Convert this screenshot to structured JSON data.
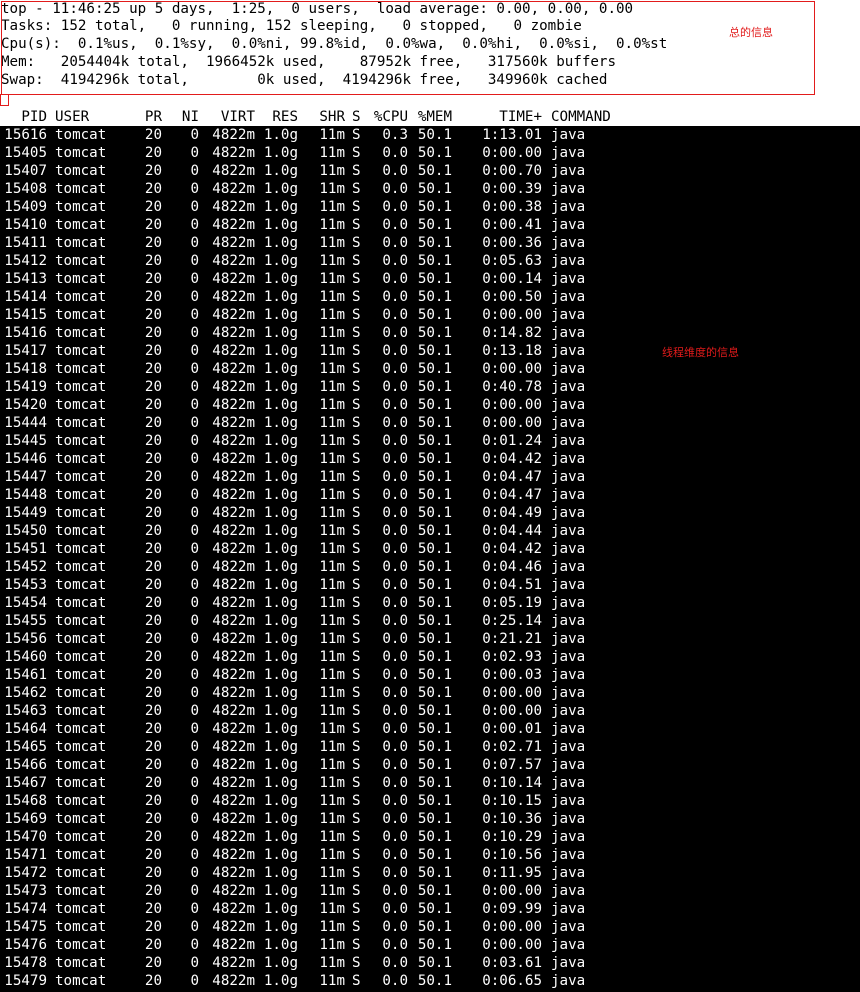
{
  "summary": {
    "lines": [
      "top - 11:46:25 up 5 days,  1:25,  0 users,  load average: 0.00, 0.00, 0.00",
      "Tasks: 152 total,   0 running, 152 sleeping,   0 stopped,   0 zombie",
      "Cpu(s):  0.1%us,  0.1%sy,  0.0%ni, 99.8%id,  0.0%wa,  0.0%hi,  0.0%si,  0.0%st",
      "Mem:   2054404k total,  1966452k used,    87952k free,   317560k buffers",
      "Swap:  4194296k total,        0k used,  4194296k free,   349960k cached"
    ],
    "annotation": "总的信息"
  },
  "table_annotation": "线程维度的信息",
  "columns": [
    "PID",
    "USER",
    "PR",
    "NI",
    "VIRT",
    "RES",
    "SHR",
    "S",
    "%CPU",
    "%MEM",
    "TIME+",
    "COMMAND"
  ],
  "rows": [
    [
      "15616",
      "tomcat",
      "20",
      "0",
      "4822m",
      "1.0g",
      "11m",
      "S",
      "0.3",
      "50.1",
      "1:13.01",
      "java"
    ],
    [
      "15405",
      "tomcat",
      "20",
      "0",
      "4822m",
      "1.0g",
      "11m",
      "S",
      "0.0",
      "50.1",
      "0:00.00",
      "java"
    ],
    [
      "15407",
      "tomcat",
      "20",
      "0",
      "4822m",
      "1.0g",
      "11m",
      "S",
      "0.0",
      "50.1",
      "0:00.70",
      "java"
    ],
    [
      "15408",
      "tomcat",
      "20",
      "0",
      "4822m",
      "1.0g",
      "11m",
      "S",
      "0.0",
      "50.1",
      "0:00.39",
      "java"
    ],
    [
      "15409",
      "tomcat",
      "20",
      "0",
      "4822m",
      "1.0g",
      "11m",
      "S",
      "0.0",
      "50.1",
      "0:00.38",
      "java"
    ],
    [
      "15410",
      "tomcat",
      "20",
      "0",
      "4822m",
      "1.0g",
      "11m",
      "S",
      "0.0",
      "50.1",
      "0:00.41",
      "java"
    ],
    [
      "15411",
      "tomcat",
      "20",
      "0",
      "4822m",
      "1.0g",
      "11m",
      "S",
      "0.0",
      "50.1",
      "0:00.36",
      "java"
    ],
    [
      "15412",
      "tomcat",
      "20",
      "0",
      "4822m",
      "1.0g",
      "11m",
      "S",
      "0.0",
      "50.1",
      "0:05.63",
      "java"
    ],
    [
      "15413",
      "tomcat",
      "20",
      "0",
      "4822m",
      "1.0g",
      "11m",
      "S",
      "0.0",
      "50.1",
      "0:00.14",
      "java"
    ],
    [
      "15414",
      "tomcat",
      "20",
      "0",
      "4822m",
      "1.0g",
      "11m",
      "S",
      "0.0",
      "50.1",
      "0:00.50",
      "java"
    ],
    [
      "15415",
      "tomcat",
      "20",
      "0",
      "4822m",
      "1.0g",
      "11m",
      "S",
      "0.0",
      "50.1",
      "0:00.00",
      "java"
    ],
    [
      "15416",
      "tomcat",
      "20",
      "0",
      "4822m",
      "1.0g",
      "11m",
      "S",
      "0.0",
      "50.1",
      "0:14.82",
      "java"
    ],
    [
      "15417",
      "tomcat",
      "20",
      "0",
      "4822m",
      "1.0g",
      "11m",
      "S",
      "0.0",
      "50.1",
      "0:13.18",
      "java"
    ],
    [
      "15418",
      "tomcat",
      "20",
      "0",
      "4822m",
      "1.0g",
      "11m",
      "S",
      "0.0",
      "50.1",
      "0:00.00",
      "java"
    ],
    [
      "15419",
      "tomcat",
      "20",
      "0",
      "4822m",
      "1.0g",
      "11m",
      "S",
      "0.0",
      "50.1",
      "0:40.78",
      "java"
    ],
    [
      "15420",
      "tomcat",
      "20",
      "0",
      "4822m",
      "1.0g",
      "11m",
      "S",
      "0.0",
      "50.1",
      "0:00.00",
      "java"
    ],
    [
      "15444",
      "tomcat",
      "20",
      "0",
      "4822m",
      "1.0g",
      "11m",
      "S",
      "0.0",
      "50.1",
      "0:00.00",
      "java"
    ],
    [
      "15445",
      "tomcat",
      "20",
      "0",
      "4822m",
      "1.0g",
      "11m",
      "S",
      "0.0",
      "50.1",
      "0:01.24",
      "java"
    ],
    [
      "15446",
      "tomcat",
      "20",
      "0",
      "4822m",
      "1.0g",
      "11m",
      "S",
      "0.0",
      "50.1",
      "0:04.42",
      "java"
    ],
    [
      "15447",
      "tomcat",
      "20",
      "0",
      "4822m",
      "1.0g",
      "11m",
      "S",
      "0.0",
      "50.1",
      "0:04.47",
      "java"
    ],
    [
      "15448",
      "tomcat",
      "20",
      "0",
      "4822m",
      "1.0g",
      "11m",
      "S",
      "0.0",
      "50.1",
      "0:04.47",
      "java"
    ],
    [
      "15449",
      "tomcat",
      "20",
      "0",
      "4822m",
      "1.0g",
      "11m",
      "S",
      "0.0",
      "50.1",
      "0:04.49",
      "java"
    ],
    [
      "15450",
      "tomcat",
      "20",
      "0",
      "4822m",
      "1.0g",
      "11m",
      "S",
      "0.0",
      "50.1",
      "0:04.44",
      "java"
    ],
    [
      "15451",
      "tomcat",
      "20",
      "0",
      "4822m",
      "1.0g",
      "11m",
      "S",
      "0.0",
      "50.1",
      "0:04.42",
      "java"
    ],
    [
      "15452",
      "tomcat",
      "20",
      "0",
      "4822m",
      "1.0g",
      "11m",
      "S",
      "0.0",
      "50.1",
      "0:04.46",
      "java"
    ],
    [
      "15453",
      "tomcat",
      "20",
      "0",
      "4822m",
      "1.0g",
      "11m",
      "S",
      "0.0",
      "50.1",
      "0:04.51",
      "java"
    ],
    [
      "15454",
      "tomcat",
      "20",
      "0",
      "4822m",
      "1.0g",
      "11m",
      "S",
      "0.0",
      "50.1",
      "0:05.19",
      "java"
    ],
    [
      "15455",
      "tomcat",
      "20",
      "0",
      "4822m",
      "1.0g",
      "11m",
      "S",
      "0.0",
      "50.1",
      "0:25.14",
      "java"
    ],
    [
      "15456",
      "tomcat",
      "20",
      "0",
      "4822m",
      "1.0g",
      "11m",
      "S",
      "0.0",
      "50.1",
      "0:21.21",
      "java"
    ],
    [
      "15460",
      "tomcat",
      "20",
      "0",
      "4822m",
      "1.0g",
      "11m",
      "S",
      "0.0",
      "50.1",
      "0:02.93",
      "java"
    ],
    [
      "15461",
      "tomcat",
      "20",
      "0",
      "4822m",
      "1.0g",
      "11m",
      "S",
      "0.0",
      "50.1",
      "0:00.03",
      "java"
    ],
    [
      "15462",
      "tomcat",
      "20",
      "0",
      "4822m",
      "1.0g",
      "11m",
      "S",
      "0.0",
      "50.1",
      "0:00.00",
      "java"
    ],
    [
      "15463",
      "tomcat",
      "20",
      "0",
      "4822m",
      "1.0g",
      "11m",
      "S",
      "0.0",
      "50.1",
      "0:00.00",
      "java"
    ],
    [
      "15464",
      "tomcat",
      "20",
      "0",
      "4822m",
      "1.0g",
      "11m",
      "S",
      "0.0",
      "50.1",
      "0:00.01",
      "java"
    ],
    [
      "15465",
      "tomcat",
      "20",
      "0",
      "4822m",
      "1.0g",
      "11m",
      "S",
      "0.0",
      "50.1",
      "0:02.71",
      "java"
    ],
    [
      "15466",
      "tomcat",
      "20",
      "0",
      "4822m",
      "1.0g",
      "11m",
      "S",
      "0.0",
      "50.1",
      "0:07.57",
      "java"
    ],
    [
      "15467",
      "tomcat",
      "20",
      "0",
      "4822m",
      "1.0g",
      "11m",
      "S",
      "0.0",
      "50.1",
      "0:10.14",
      "java"
    ],
    [
      "15468",
      "tomcat",
      "20",
      "0",
      "4822m",
      "1.0g",
      "11m",
      "S",
      "0.0",
      "50.1",
      "0:10.15",
      "java"
    ],
    [
      "15469",
      "tomcat",
      "20",
      "0",
      "4822m",
      "1.0g",
      "11m",
      "S",
      "0.0",
      "50.1",
      "0:10.36",
      "java"
    ],
    [
      "15470",
      "tomcat",
      "20",
      "0",
      "4822m",
      "1.0g",
      "11m",
      "S",
      "0.0",
      "50.1",
      "0:10.29",
      "java"
    ],
    [
      "15471",
      "tomcat",
      "20",
      "0",
      "4822m",
      "1.0g",
      "11m",
      "S",
      "0.0",
      "50.1",
      "0:10.56",
      "java"
    ],
    [
      "15472",
      "tomcat",
      "20",
      "0",
      "4822m",
      "1.0g",
      "11m",
      "S",
      "0.0",
      "50.1",
      "0:11.95",
      "java"
    ],
    [
      "15473",
      "tomcat",
      "20",
      "0",
      "4822m",
      "1.0g",
      "11m",
      "S",
      "0.0",
      "50.1",
      "0:00.00",
      "java"
    ],
    [
      "15474",
      "tomcat",
      "20",
      "0",
      "4822m",
      "1.0g",
      "11m",
      "S",
      "0.0",
      "50.1",
      "0:09.99",
      "java"
    ],
    [
      "15475",
      "tomcat",
      "20",
      "0",
      "4822m",
      "1.0g",
      "11m",
      "S",
      "0.0",
      "50.1",
      "0:00.00",
      "java"
    ],
    [
      "15476",
      "tomcat",
      "20",
      "0",
      "4822m",
      "1.0g",
      "11m",
      "S",
      "0.0",
      "50.1",
      "0:00.00",
      "java"
    ],
    [
      "15478",
      "tomcat",
      "20",
      "0",
      "4822m",
      "1.0g",
      "11m",
      "S",
      "0.0",
      "50.1",
      "0:03.61",
      "java"
    ],
    [
      "15479",
      "tomcat",
      "20",
      "0",
      "4822m",
      "1.0g",
      "11m",
      "S",
      "0.0",
      "50.1",
      "0:06.65",
      "java"
    ]
  ],
  "colors": {
    "annotation_red": "#e21b1b",
    "terminal_bg": "#000000",
    "terminal_fg": "#ffffff"
  }
}
